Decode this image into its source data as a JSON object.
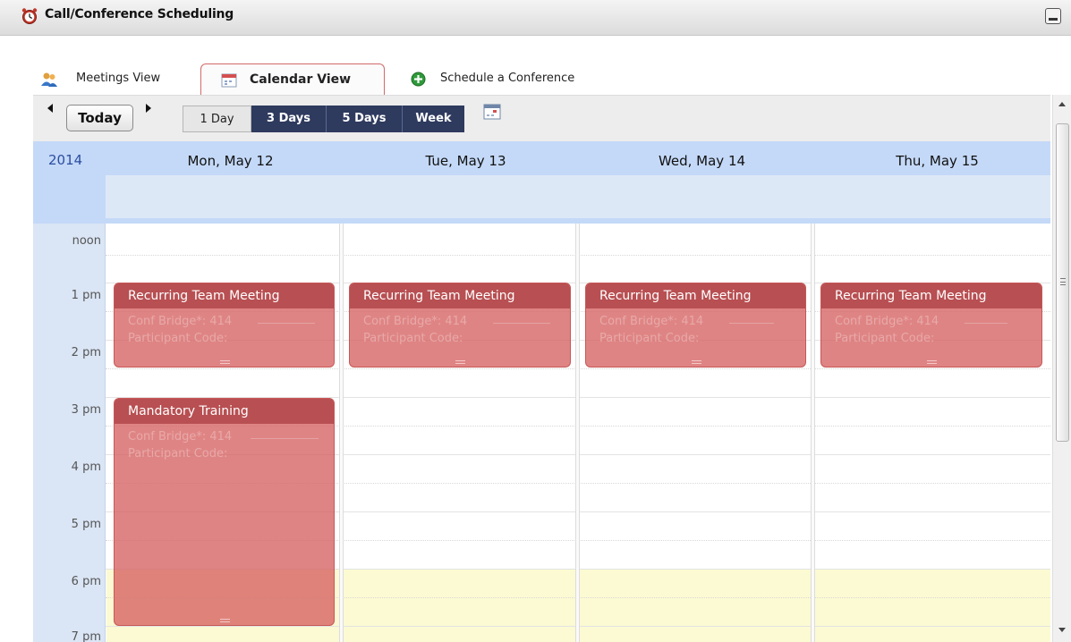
{
  "window": {
    "title": "Call/Conference Scheduling"
  },
  "tabs": [
    {
      "label": "Meetings View",
      "icon": "people-icon",
      "active": false
    },
    {
      "label": "Calendar View",
      "icon": "calendar-icon",
      "active": true
    },
    {
      "label": "Schedule a Conference",
      "icon": "add-icon",
      "active": false
    }
  ],
  "toolbar": {
    "today_label": "Today",
    "ranges": [
      "1 Day",
      "3 Days",
      "5 Days",
      "Week"
    ],
    "selected_range": "1 Day"
  },
  "calendar": {
    "year": "2014",
    "days": [
      "Mon, May 12",
      "Tue, May 13",
      "Wed, May 14",
      "Thu, May 15"
    ],
    "hours": [
      "noon",
      "1 pm",
      "2 pm",
      "3 pm",
      "4 pm",
      "5 pm",
      "6 pm",
      "7 pm"
    ],
    "events": [
      {
        "title": "Recurring Team Meeting",
        "line1": "Conf Bridge*: 414",
        "line2": "Participant Code:",
        "day": 0,
        "start": "1 pm",
        "end": "2:30 pm"
      },
      {
        "title": "Recurring Team Meeting",
        "line1": "Conf Bridge*: 414",
        "line2": "Participant Code:",
        "day": 1,
        "start": "1 pm",
        "end": "2:30 pm"
      },
      {
        "title": "Recurring Team Meeting",
        "line1": "Conf Bridge*: 414",
        "line2": "Participant Code:",
        "day": 2,
        "start": "1 pm",
        "end": "2:30 pm"
      },
      {
        "title": "Recurring Team Meeting",
        "line1": "Conf Bridge*: 414",
        "line2": "Participant Code:",
        "day": 3,
        "start": "1 pm",
        "end": "2:30 pm"
      },
      {
        "title": "Mandatory Training",
        "line1": "Conf Bridge*: 414",
        "line2": "Participant Code:",
        "day": 0,
        "start": "3 pm",
        "end": "7 pm"
      }
    ]
  },
  "colors": {
    "event_fill": "#d66262",
    "event_header": "#b84f52",
    "header_blue": "#c4d9f8",
    "range_button_dark": "#2e3a5e",
    "after_hours": "#fcfad2"
  }
}
